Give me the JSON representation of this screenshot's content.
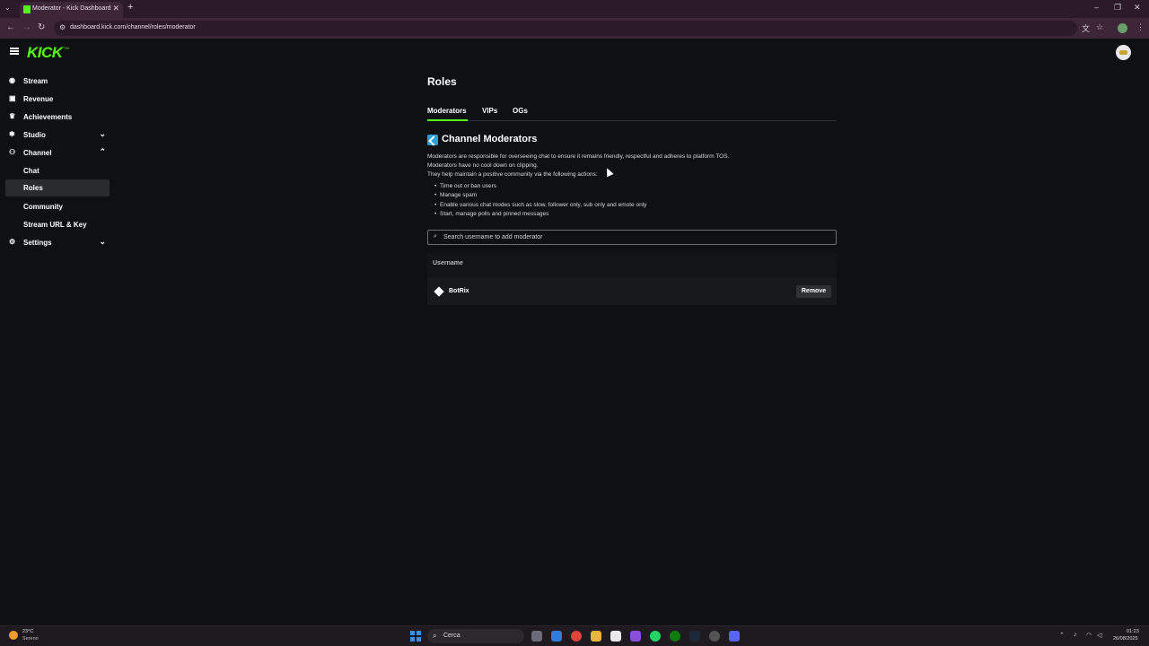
{
  "browser": {
    "tab_title": "Moderator - Kick Dashboard",
    "url": "dashboard.kick.com/channel/roles/moderator"
  },
  "header": {
    "logo": "KICK",
    "logo_tm": "TM"
  },
  "sidebar": {
    "items": [
      {
        "label": "Stream",
        "icon": "broadcast-icon"
      },
      {
        "label": "Revenue",
        "icon": "revenue-icon"
      },
      {
        "label": "Achievements",
        "icon": "trophy-icon"
      },
      {
        "label": "Studio",
        "icon": "studio-icon",
        "chevron": "down"
      },
      {
        "label": "Channel",
        "icon": "channel-icon",
        "chevron": "up"
      },
      {
        "label": "Chat"
      },
      {
        "label": "Roles",
        "active": true
      },
      {
        "label": "Community"
      },
      {
        "label": "Stream URL & Key"
      },
      {
        "label": "Settings",
        "icon": "gear-icon",
        "chevron": "down"
      }
    ]
  },
  "main": {
    "title": "Roles",
    "tabs": [
      {
        "label": "Moderators",
        "active": true
      },
      {
        "label": "VIPs"
      },
      {
        "label": "OGs"
      }
    ],
    "section_title": "Channel Moderators",
    "description": [
      "Moderators are responsible for overseeing chat to ensure it remains friendly, respectful and adheres to platform TOS.",
      "Moderators have no cool down on clipping.",
      "They help maintain a positive community via the following actions:"
    ],
    "actions": [
      "Time out or ban users",
      "Manage spam",
      "Enable various chat modes such as slow, follower only, sub only and emote only",
      "Start, manage polls and pinned messages"
    ],
    "search_placeholder": "Search username to add moderator",
    "table": {
      "header": "Username",
      "rows": [
        {
          "username": "BotRix",
          "action": "Remove"
        }
      ]
    }
  },
  "taskbar": {
    "weather_temp": "23°C",
    "weather_desc": "Sereno",
    "search_label": "Cerca",
    "time": "01:23",
    "date": "26/08/2025"
  },
  "colors": {
    "accent": "#53fc18",
    "background": "#0f1011"
  }
}
